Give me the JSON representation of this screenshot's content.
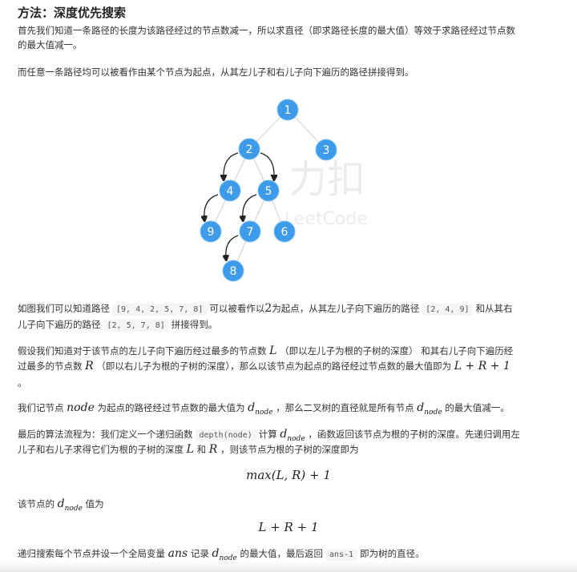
{
  "title": "方法：深度优先搜索",
  "p1": {
    "line1": "首先我们知道一条路径的长度为该路径经过的节点数减一，所以求直径（即求路径长度的最大值）等效于求路径经过节点数",
    "line2": "的最大值减一。"
  },
  "p2": "而任意一条路径均可以被看作由某个节点为起点，从其左儿子和右儿子向下遍历的路径拼接得到。",
  "tree": {
    "nodes": [
      "1",
      "2",
      "3",
      "4",
      "5",
      "9",
      "7",
      "6",
      "8"
    ],
    "watermark": {
      "cn": "力扣",
      "en": "LeetCode"
    },
    "colors": {
      "node": "#3d9be9",
      "edge": "#dddddd",
      "arrow": "#222222"
    }
  },
  "p3": {
    "a": "如图我们可以知道路径",
    "code1": "[9, 4, 2, 5, 7, 8]",
    "b": "可以被看作以",
    "m1": "2",
    "c": "为起点，从其左儿子向下遍历的路径",
    "code2": "[2, 4, 9]",
    "d": "和从其右",
    "e": "儿子向下遍历的路径",
    "code3": "[2, 5, 7, 8]",
    "f": "拼接得到。"
  },
  "p4": {
    "a": "假设我们知道对于该节点的左儿子向下遍历经过最多的节点数",
    "L": "L",
    "b": "（即以左儿子为根的子树的深度） 和其右儿子向下遍历经",
    "c": "过最多的节点数",
    "R": "R",
    "d": "（即以右儿子为根的子树的深度），那么以该节点为起点的路径经过节点数的最大值即为",
    "expr": "L + R + 1",
    "dot": "。"
  },
  "p5": {
    "a": "我们记节点",
    "node": "node",
    "b": "为起点的路径经过节点数的最大值为",
    "d": "d",
    "sub": "node",
    "c": "，那么二叉树的直径就是所有节点",
    "e": "的最大值减一。"
  },
  "p6": {
    "a": "最后的算法流程为：我们定义一个递归函数",
    "code": "depth(node)",
    "b": "计算",
    "c": "，函数返回该节点为根的子树的深度。先递归调用左",
    "d": "儿子和右儿子求得它们为根的子树的深度",
    "L": "L",
    "and": "和",
    "R": "R",
    "e": "，则该节点为根的子树的深度即为"
  },
  "formula1": "max(L, R) + 1",
  "p7": {
    "a": "该节点的",
    "b": "值为"
  },
  "formula2": "L + R + 1",
  "p8": {
    "a": "递归搜索每个节点并设一个全局变量",
    "ans": "ans",
    "b": "记录",
    "c": "的最大值，最后返回",
    "code": "ans-1",
    "d": "即为树的直径。"
  }
}
